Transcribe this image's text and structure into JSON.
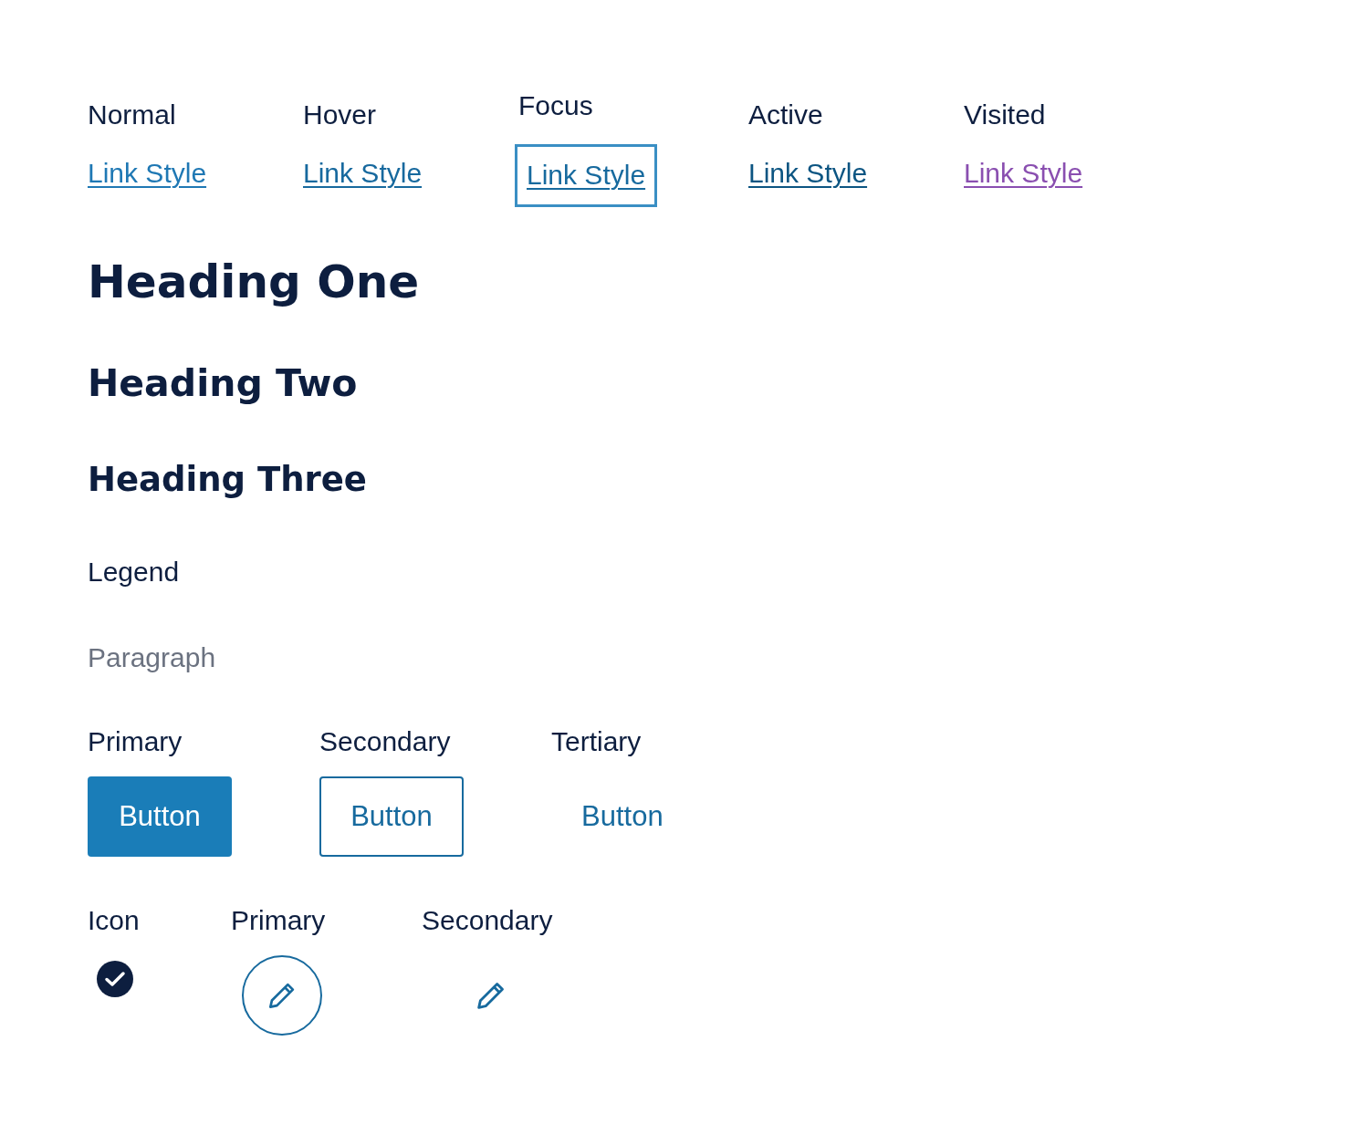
{
  "links": [
    {
      "label": "Normal",
      "text": "Link Style",
      "kind": "normal"
    },
    {
      "label": "Hover",
      "text": "Link Style",
      "kind": "hover"
    },
    {
      "label": "Focus",
      "text": "Link Style",
      "kind": "focus"
    },
    {
      "label": "Active",
      "text": "Link Style",
      "kind": "active"
    },
    {
      "label": "Visited",
      "text": "Link Style",
      "kind": "visited"
    }
  ],
  "headings": {
    "one": "Heading One",
    "two": "Heading Two",
    "three": "Heading Three"
  },
  "legend": "Legend",
  "paragraph": "Paragraph",
  "buttons": [
    {
      "label": "Primary",
      "text": "Button",
      "kind": "primary"
    },
    {
      "label": "Secondary",
      "text": "Button",
      "kind": "secondary"
    },
    {
      "label": "Tertiary",
      "text": "Button",
      "kind": "tertiary"
    }
  ],
  "icons": [
    {
      "label": "Icon",
      "kind": "check"
    },
    {
      "label": "Primary",
      "kind": "primary"
    },
    {
      "label": "Secondary",
      "kind": "secondary"
    }
  ]
}
